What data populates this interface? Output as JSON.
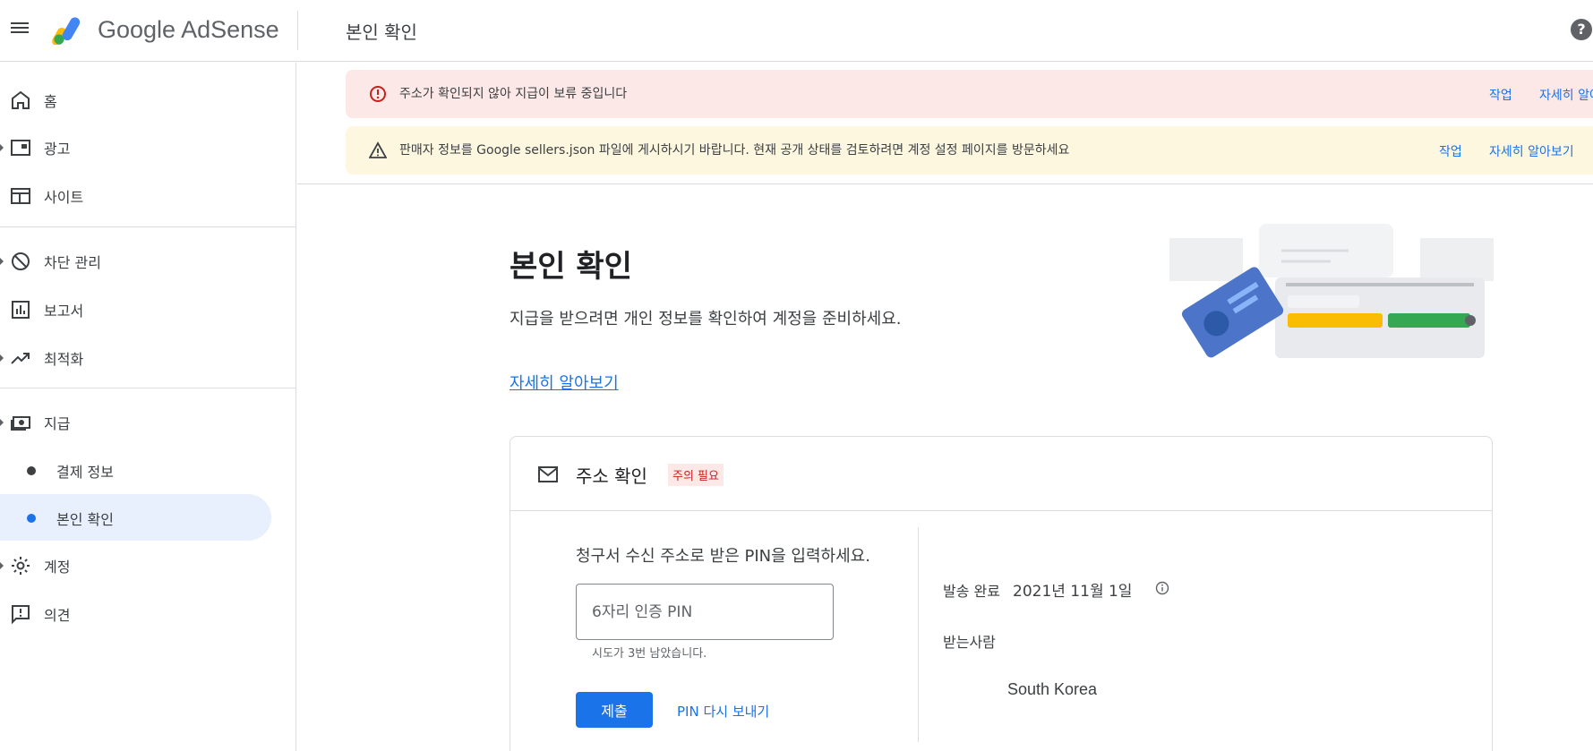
{
  "header": {
    "brand": "Google AdSense",
    "page_title": "본인 확인",
    "help_icon": "?"
  },
  "sidebar": {
    "items": [
      {
        "label": "홈",
        "icon": "home-icon"
      },
      {
        "label": "광고",
        "icon": "ads-icon"
      },
      {
        "label": "사이트",
        "icon": "sites-icon"
      },
      {
        "label": "차단 관리",
        "icon": "block-icon"
      },
      {
        "label": "보고서",
        "icon": "reports-icon"
      },
      {
        "label": "최적화",
        "icon": "trending-up-icon"
      },
      {
        "label": "지급",
        "icon": "payments-icon"
      },
      {
        "label": "계정",
        "icon": "gear-icon"
      },
      {
        "label": "의견",
        "icon": "feedback-icon"
      }
    ],
    "sub_items": [
      {
        "label": "결제 정보"
      },
      {
        "label": "본인 확인"
      }
    ]
  },
  "banners": {
    "error": {
      "text": "주소가 확인되지 않아 지급이 보류 중입니다",
      "action": "작업",
      "learn_more": "자세히 알아보기"
    },
    "warning": {
      "text": "판매자 정보를 Google sellers.json 파일에 게시하시기 바랍니다. 현재 공개 상태를 검토하려면 계정 설정 페이지를 방문하세요",
      "action": "작업",
      "learn_more": "자세히 알아보기"
    }
  },
  "intro": {
    "title": "본인 확인",
    "description": "지급을 받으려면 개인 정보를 확인하여 계정을 준비하세요.",
    "learn_more": "자세히 알아보기"
  },
  "address_card": {
    "title": "주소 확인",
    "badge": "주의 필요",
    "prompt": "청구서 수신 주소로 받은 PIN을 입력하세요.",
    "pin_placeholder": "6자리 인증 PIN",
    "pin_value": "",
    "attempts": "시도가 3번 남았습니다.",
    "submit": "제출",
    "resend": "PIN 다시 보내기",
    "sent_label": "발송 완료",
    "sent_date": "2021년 11월 1일",
    "recipient_label": "받는사람",
    "recipient_country": "South Korea"
  },
  "colors": {
    "accent": "#1a73e8",
    "error_bg": "#fce8e6",
    "warning_bg": "#fef7e0",
    "active_nav_bg": "#e8f0fe",
    "badge_text": "#c5221f"
  }
}
